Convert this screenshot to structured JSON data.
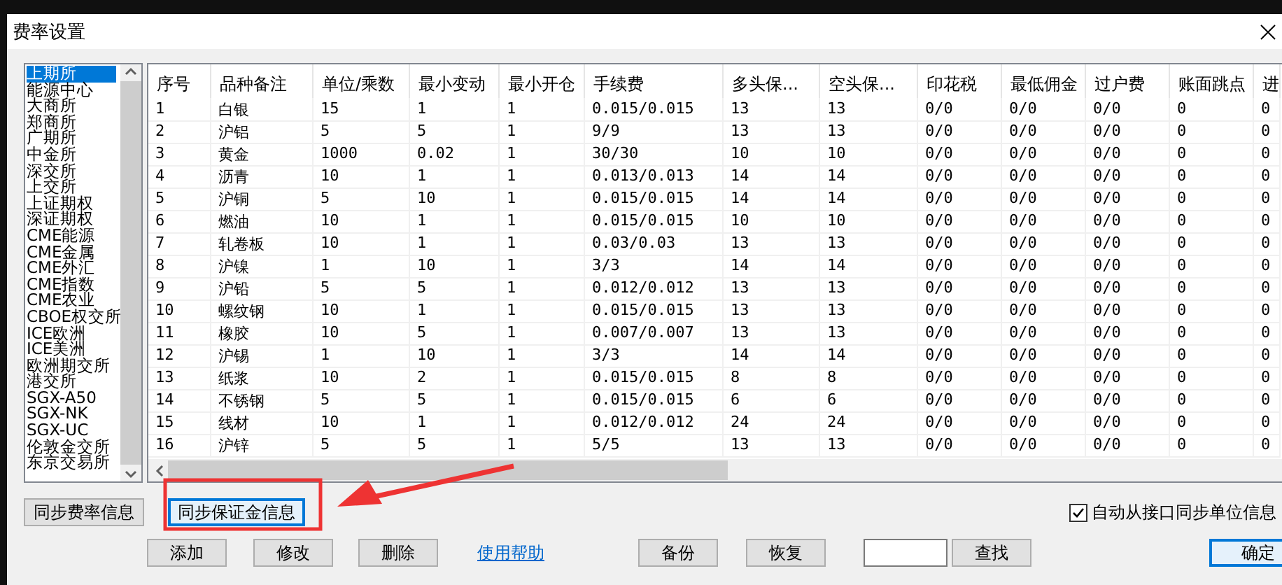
{
  "window": {
    "title": "费率设置"
  },
  "exchanges": [
    {
      "label": "上期所",
      "selected": true
    },
    {
      "label": "能源中心",
      "selected": false
    },
    {
      "label": "大商所",
      "selected": false
    },
    {
      "label": "郑商所",
      "selected": false
    },
    {
      "label": "广期所",
      "selected": false
    },
    {
      "label": "中金所",
      "selected": false
    },
    {
      "label": "深交所",
      "selected": false
    },
    {
      "label": "上交所",
      "selected": false
    },
    {
      "label": "上证期权",
      "selected": false
    },
    {
      "label": "深证期权",
      "selected": false
    },
    {
      "label": "CME能源",
      "selected": false
    },
    {
      "label": "CME金属",
      "selected": false
    },
    {
      "label": "CME外汇",
      "selected": false
    },
    {
      "label": "CME指数",
      "selected": false
    },
    {
      "label": "CME农业",
      "selected": false
    },
    {
      "label": "CBOE权交所",
      "selected": false
    },
    {
      "label": "ICE欧洲",
      "selected": false
    },
    {
      "label": "ICE美洲",
      "selected": false
    },
    {
      "label": "欧洲期交所",
      "selected": false
    },
    {
      "label": "港交所",
      "selected": false
    },
    {
      "label": "SGX-A50",
      "selected": false
    },
    {
      "label": "SGX-NK",
      "selected": false
    },
    {
      "label": "SGX-UC",
      "selected": false
    },
    {
      "label": "伦敦金交所",
      "selected": false
    },
    {
      "label": "东京交易所",
      "selected": false
    }
  ],
  "table": {
    "columns": [
      "序号",
      "品种备注",
      "单位/乘数",
      "最小变动",
      "最小开仓",
      "手续费",
      "多头保...",
      "空头保...",
      "印花税",
      "最低佣金",
      "过户费",
      "账面跳点",
      "进"
    ],
    "rows": [
      [
        "1",
        "白银",
        "15",
        "1",
        "1",
        "0.015/0.015",
        "13",
        "13",
        "0/0",
        "0/0",
        "0/0",
        "0",
        "0"
      ],
      [
        "2",
        "沪铝",
        "5",
        "5",
        "1",
        "9/9",
        "13",
        "13",
        "0/0",
        "0/0",
        "0/0",
        "0",
        "0"
      ],
      [
        "3",
        "黄金",
        "1000",
        "0.02",
        "1",
        "30/30",
        "10",
        "10",
        "0/0",
        "0/0",
        "0/0",
        "0",
        "0"
      ],
      [
        "4",
        "沥青",
        "10",
        "1",
        "1",
        "0.013/0.013",
        "14",
        "14",
        "0/0",
        "0/0",
        "0/0",
        "0",
        "0"
      ],
      [
        "5",
        "沪铜",
        "5",
        "10",
        "1",
        "0.015/0.015",
        "14",
        "14",
        "0/0",
        "0/0",
        "0/0",
        "0",
        "0"
      ],
      [
        "6",
        "燃油",
        "10",
        "1",
        "1",
        "0.015/0.015",
        "10",
        "10",
        "0/0",
        "0/0",
        "0/0",
        "0",
        "0"
      ],
      [
        "7",
        "轧卷板",
        "10",
        "1",
        "1",
        "0.03/0.03",
        "13",
        "13",
        "0/0",
        "0/0",
        "0/0",
        "0",
        "0"
      ],
      [
        "8",
        "沪镍",
        "1",
        "10",
        "1",
        "3/3",
        "14",
        "14",
        "0/0",
        "0/0",
        "0/0",
        "0",
        "0"
      ],
      [
        "9",
        "沪铅",
        "5",
        "5",
        "1",
        "0.012/0.012",
        "13",
        "13",
        "0/0",
        "0/0",
        "0/0",
        "0",
        "0"
      ],
      [
        "10",
        "螺纹钢",
        "10",
        "1",
        "1",
        "0.015/0.015",
        "13",
        "13",
        "0/0",
        "0/0",
        "0/0",
        "0",
        "0"
      ],
      [
        "11",
        "橡胶",
        "10",
        "5",
        "1",
        "0.007/0.007",
        "13",
        "13",
        "0/0",
        "0/0",
        "0/0",
        "0",
        "0"
      ],
      [
        "12",
        "沪锡",
        "1",
        "10",
        "1",
        "3/3",
        "14",
        "14",
        "0/0",
        "0/0",
        "0/0",
        "0",
        "0"
      ],
      [
        "13",
        "纸浆",
        "10",
        "2",
        "1",
        "0.015/0.015",
        "8",
        "8",
        "0/0",
        "0/0",
        "0/0",
        "0",
        "0"
      ],
      [
        "14",
        "不锈钢",
        "5",
        "5",
        "1",
        "0.015/0.015",
        "6",
        "6",
        "0/0",
        "0/0",
        "0/0",
        "0",
        "0"
      ],
      [
        "15",
        "线材",
        "10",
        "1",
        "1",
        "0.012/0.012",
        "24",
        "24",
        "0/0",
        "0/0",
        "0/0",
        "0",
        "0"
      ],
      [
        "16",
        "沪锌",
        "5",
        "5",
        "1",
        "5/5",
        "13",
        "13",
        "0/0",
        "0/0",
        "0/0",
        "0",
        "0"
      ]
    ]
  },
  "sync_buttons": [
    {
      "label": "同步费率信息",
      "focused": false
    },
    {
      "label": "同步保证金信息",
      "focused": true
    }
  ],
  "auto_sync": {
    "label": "自动从接口同步单位信息",
    "checked": true
  },
  "actions": [
    {
      "kind": "button",
      "label": "添加",
      "focused": false
    },
    {
      "kind": "button",
      "label": "修改",
      "focused": false
    },
    {
      "kind": "button",
      "label": "删除",
      "focused": false
    },
    {
      "kind": "link",
      "label": "使用帮助"
    },
    {
      "kind": "button",
      "label": "备份",
      "focused": false
    },
    {
      "kind": "button",
      "label": "恢复",
      "focused": false
    },
    {
      "kind": "field"
    },
    {
      "kind": "button",
      "label": "查找",
      "focused": false
    },
    {
      "kind": "button",
      "label": "确定",
      "focused": true
    }
  ]
}
